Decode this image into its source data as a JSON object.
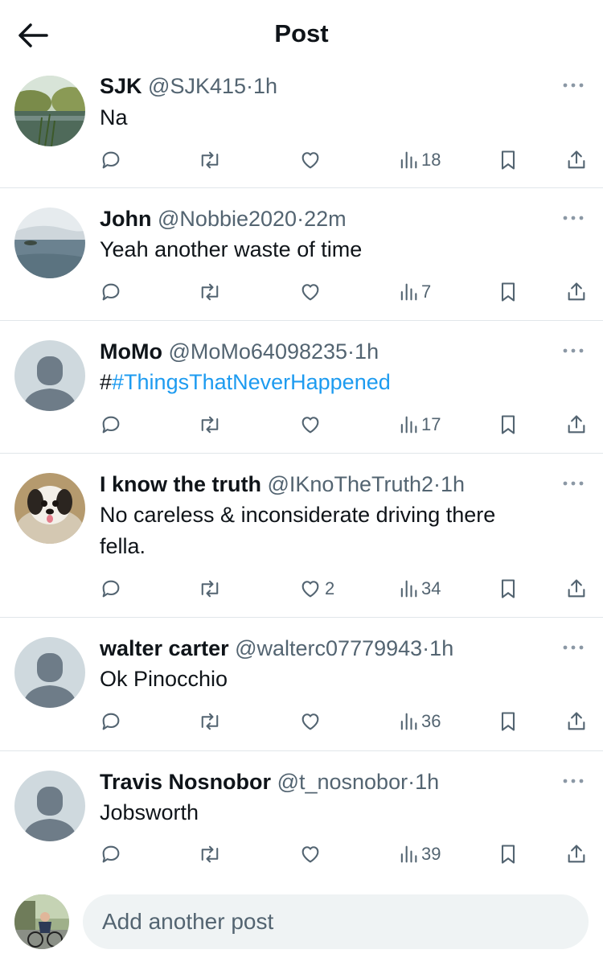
{
  "header": {
    "title": "Post"
  },
  "replies": [
    {
      "name": "SJK",
      "handle": "@SJK415",
      "sep": "·",
      "time": "1h",
      "text": "Na",
      "stats": {
        "replies": "",
        "reposts": "",
        "likes": "",
        "views": "18"
      }
    },
    {
      "name": "John",
      "handle": "@Nobbie2020",
      "sep": "·",
      "time": "22m",
      "text": "Yeah another waste of time",
      "stats": {
        "replies": "",
        "reposts": "",
        "likes": "",
        "views": "7"
      }
    },
    {
      "name": "MoMo",
      "handle": "@MoMo64098235",
      "sep": "·",
      "time": "1h",
      "text_prefix": "#",
      "hashtag": "#ThingsThatNeverHappened",
      "stats": {
        "replies": "",
        "reposts": "",
        "likes": "",
        "views": "17"
      }
    },
    {
      "name": "I know the truth",
      "handle": "@IKnoTheTruth2",
      "sep": "·",
      "time": "1h",
      "text_line1": "No careless & inconsiderate driving there",
      "text_line2": "fella.",
      "stats": {
        "replies": "",
        "reposts": "",
        "likes": "2",
        "views": "34"
      }
    },
    {
      "name": "walter carter",
      "handle": "@walterc07779943",
      "sep": "·",
      "time": "1h",
      "text": "Ok Pinocchio",
      "stats": {
        "replies": "",
        "reposts": "",
        "likes": "",
        "views": "36"
      }
    },
    {
      "name": "Travis Nosnobor",
      "handle": "@t_nosnobor",
      "sep": "·",
      "time": "1h",
      "text": "Jobsworth",
      "stats": {
        "replies": "",
        "reposts": "",
        "likes": "",
        "views": "39"
      }
    }
  ],
  "composer": {
    "placeholder": "Add another post"
  },
  "icons": {
    "back": "arrow-left-icon",
    "more": "more-horizontal-icon",
    "reply": "reply-bubble-icon",
    "repost": "repost-icon",
    "like": "heart-icon",
    "views": "views-bars-icon",
    "bookmark": "bookmark-icon",
    "share": "share-icon"
  },
  "colors": {
    "text": "#0f1419",
    "secondary": "#536471",
    "link": "#1d9bf0",
    "divider": "#e1e6ea",
    "input_bg": "#eff3f4"
  }
}
